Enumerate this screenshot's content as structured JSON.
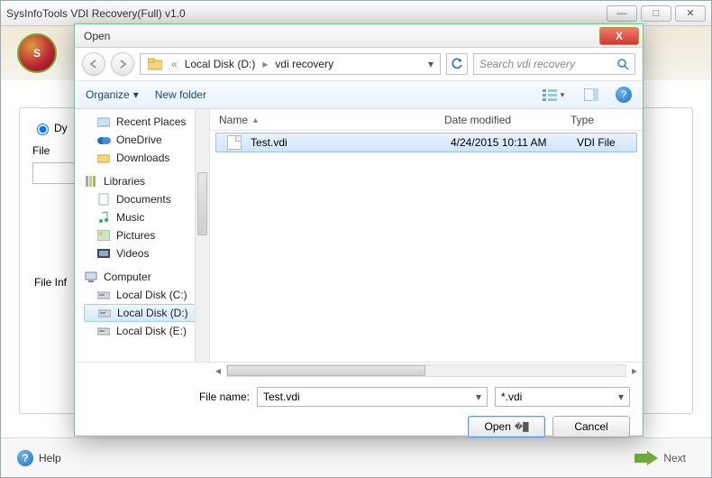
{
  "main": {
    "title": "SysInfoTools VDI Recovery(Full) v1.0",
    "logo_letter": "S",
    "radio_dynamic_prefix": "Dy",
    "file_label_prefix": "File",
    "file_info_prefix": "File Inf",
    "help_label": "Help",
    "next_label": "Next"
  },
  "dialog": {
    "title": "Open",
    "breadcrumb": {
      "prefix": "«",
      "seg1": "Local Disk (D:)",
      "seg2": "vdi recovery"
    },
    "search_placeholder": "Search vdi recovery",
    "toolbar": {
      "organize": "Organize",
      "new_folder": "New folder"
    },
    "tree": {
      "recent": "Recent Places",
      "onedrive": "OneDrive",
      "downloads": "Downloads",
      "libraries": "Libraries",
      "documents": "Documents",
      "music": "Music",
      "pictures": "Pictures",
      "videos": "Videos",
      "computer": "Computer",
      "disk_c": "Local Disk (C:)",
      "disk_d": "Local Disk (D:)",
      "disk_e": "Local Disk (E:)"
    },
    "columns": {
      "name": "Name",
      "date": "Date modified",
      "type": "Type"
    },
    "file": {
      "name": "Test.vdi",
      "date": "4/24/2015 10:11 AM",
      "type": "VDI File"
    },
    "filename_label": "File name:",
    "filename_value": "Test.vdi",
    "filter_value": "*.vdi",
    "open_btn": "Open",
    "cancel_btn": "Cancel"
  }
}
